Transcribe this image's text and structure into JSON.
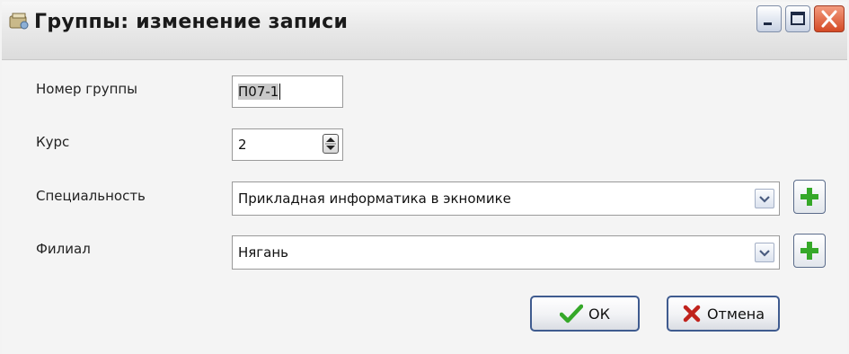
{
  "window": {
    "title": "Группы: изменение записи",
    "controls": [
      "minimize-icon",
      "maximize-icon",
      "close-icon"
    ]
  },
  "form": {
    "group_number": {
      "label": "Номер группы",
      "value": "П07-1"
    },
    "course": {
      "label": "Курс",
      "value": "2"
    },
    "specialty": {
      "label": "Специальность",
      "value": "Прикладная информатика в экномике"
    },
    "branch": {
      "label": "Филиал",
      "value": "Нягань"
    }
  },
  "buttons": {
    "ok_label": "ОК",
    "cancel_label": "Отмена"
  },
  "colors": {
    "accent_green": "#35a829",
    "cancel_red": "#c0221c",
    "close_red": "#d44a25",
    "border_blue": "#3f5b8f"
  }
}
